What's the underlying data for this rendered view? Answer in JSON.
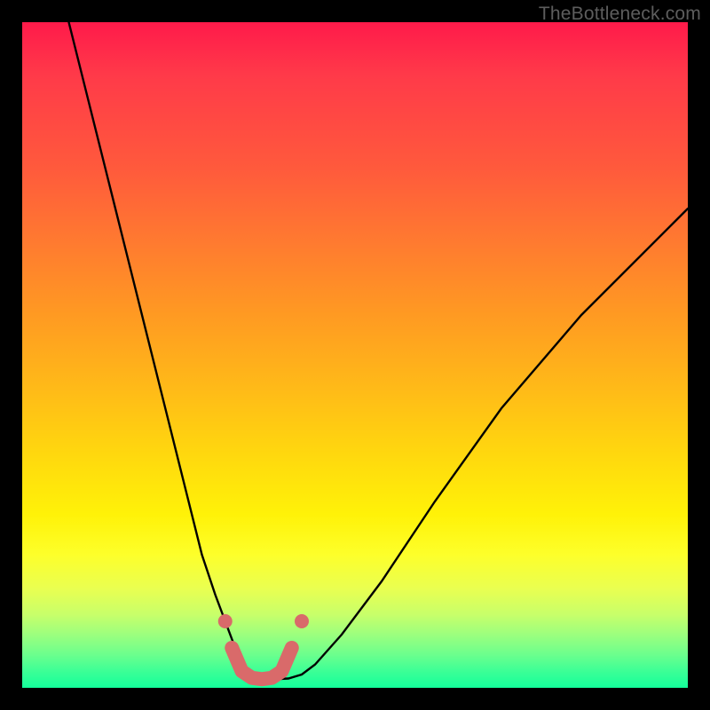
{
  "watermark": "TheBottleneck.com",
  "chart_data": {
    "type": "line",
    "title": "",
    "xlabel": "",
    "ylabel": "",
    "xlim": [
      0,
      100
    ],
    "ylim": [
      0,
      100
    ],
    "grid": false,
    "legend": false,
    "series": [
      {
        "name": "bottleneck-curve",
        "x": [
          7,
          10,
          13,
          16,
          19,
          22,
          25,
          27,
          29,
          30.5,
          32,
          33,
          34,
          35,
          36,
          38,
          40,
          42,
          44,
          48,
          54,
          62,
          72,
          84,
          100
        ],
        "y": [
          100,
          88,
          76,
          64,
          52,
          40,
          28,
          20,
          14,
          10,
          6,
          3.5,
          2.0,
          1.4,
          1.3,
          1.3,
          1.4,
          2.0,
          3.5,
          8,
          16,
          28,
          42,
          56,
          72
        ]
      }
    ],
    "markers": [
      {
        "name": "left-dot",
        "x": 30.5,
        "y": 10
      },
      {
        "name": "right-dot",
        "x": 42,
        "y": 10
      }
    ],
    "highlight_segment": {
      "name": "valley-floor",
      "x": [
        31.5,
        33,
        34.5,
        36,
        37.5,
        39,
        40.5
      ],
      "y": [
        6,
        2.5,
        1.5,
        1.3,
        1.5,
        2.5,
        6
      ]
    },
    "background_gradient": {
      "orientation": "vertical",
      "stops": [
        {
          "pos": 0.0,
          "color": "#ff1a4a"
        },
        {
          "pos": 0.33,
          "color": "#ff7a30"
        },
        {
          "pos": 0.65,
          "color": "#ffd80e"
        },
        {
          "pos": 0.85,
          "color": "#eaff50"
        },
        {
          "pos": 1.0,
          "color": "#14ff9b"
        }
      ]
    }
  }
}
